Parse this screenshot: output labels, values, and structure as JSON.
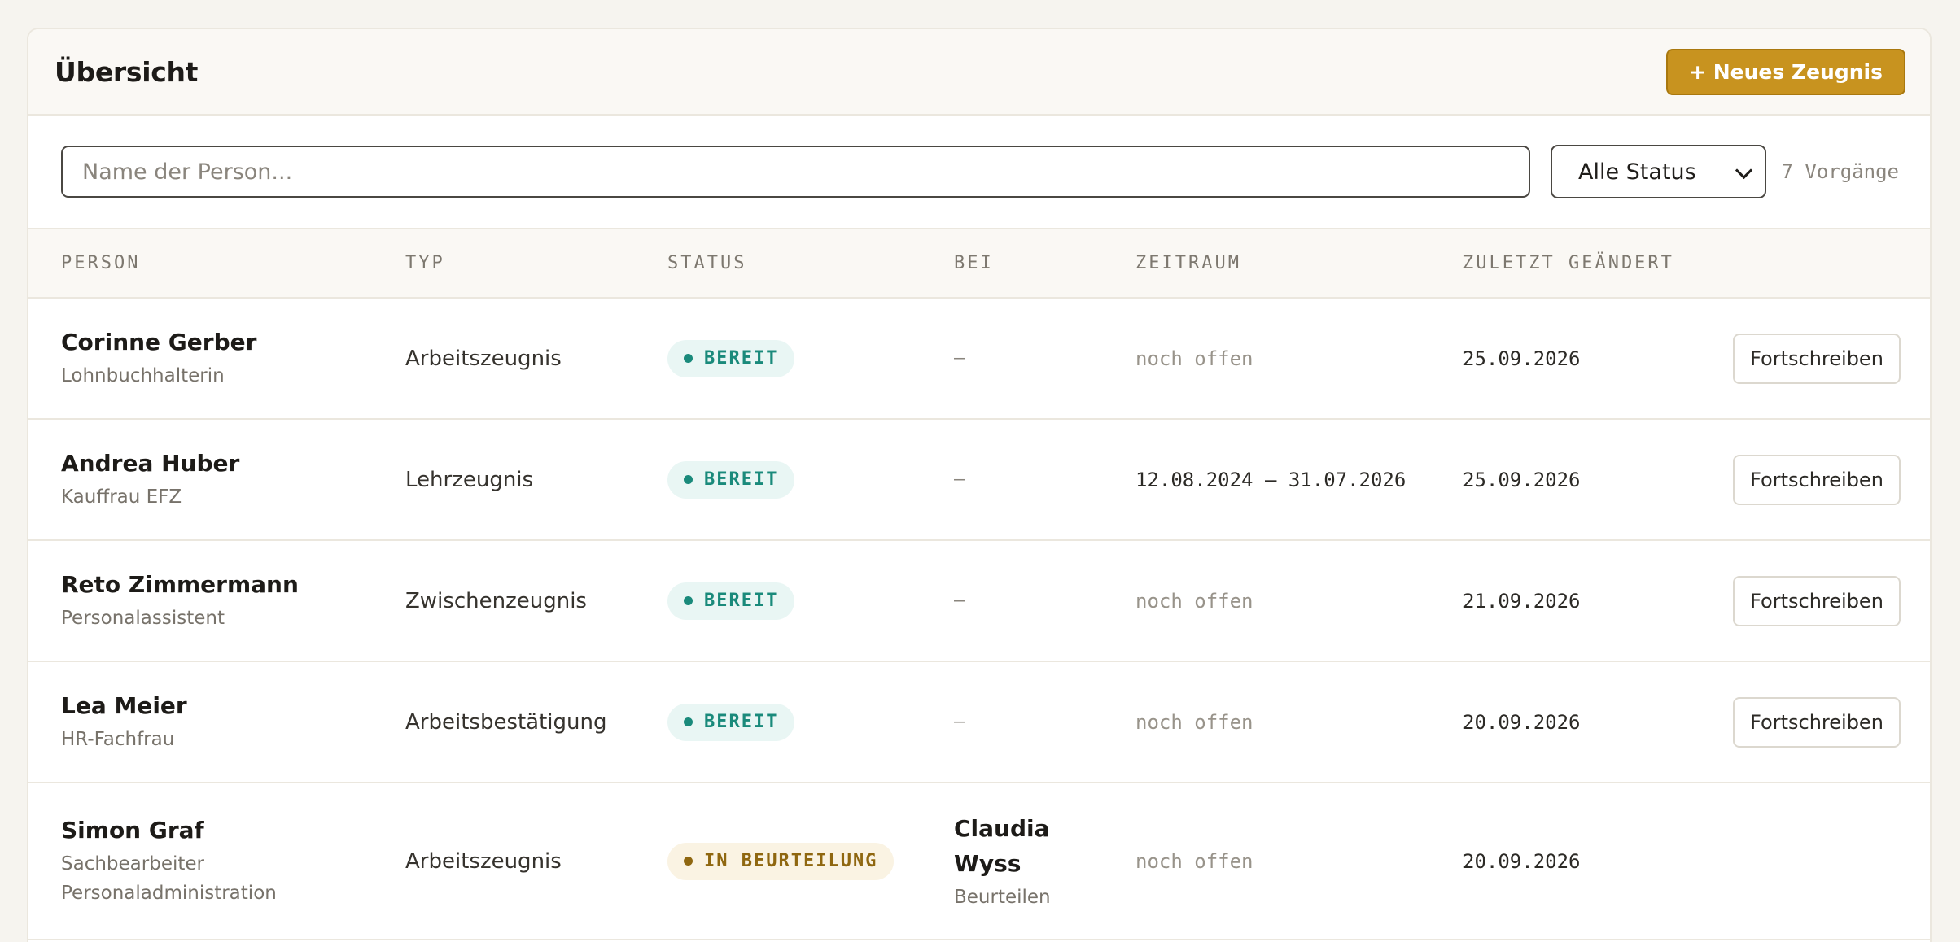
{
  "header": {
    "title": "Übersicht",
    "new_button_label": "+ Neues Zeugnis"
  },
  "toolbar": {
    "search_placeholder": "Name der Person...",
    "search_value": "",
    "status_filter_selected": "Alle Status",
    "count_label": "7 Vorgänge"
  },
  "table": {
    "columns": [
      "PERSON",
      "TYP",
      "STATUS",
      "BEI",
      "ZEITRAUM",
      "ZULETZT GEÄNDERT"
    ],
    "rows": [
      {
        "name": "Corinne Gerber",
        "role": "Lohnbuchhalterin",
        "type": "Arbeitszeugnis",
        "status": "BEREIT",
        "assignee": "—",
        "assignee_action": "",
        "period": "noch offen",
        "changed": "25.09.2026",
        "action": "Fortschreiben"
      },
      {
        "name": "Andrea Huber",
        "role": "Kauffrau EFZ",
        "type": "Lehrzeugnis",
        "status": "BEREIT",
        "assignee": "—",
        "assignee_action": "",
        "period": "12.08.2024 – 31.07.2026",
        "changed": "25.09.2026",
        "action": "Fortschreiben"
      },
      {
        "name": "Reto Zimmermann",
        "role": "Personalassistent",
        "type": "Zwischenzeugnis",
        "status": "BEREIT",
        "assignee": "—",
        "assignee_action": "",
        "period": "noch offen",
        "changed": "21.09.2026",
        "action": "Fortschreiben"
      },
      {
        "name": "Lea Meier",
        "role": "HR-Fachfrau",
        "type": "Arbeitsbestätigung",
        "status": "BEREIT",
        "assignee": "—",
        "assignee_action": "",
        "period": "noch offen",
        "changed": "20.09.2026",
        "action": "Fortschreiben"
      },
      {
        "name": "Simon Graf",
        "role": "Sachbearbeiter Personaladministration",
        "type": "Arbeitszeugnis",
        "status": "IN BEURTEILUNG",
        "assignee": "Claudia Wyss",
        "assignee_action": "Beurteilen",
        "period": "noch offen",
        "changed": "20.09.2026",
        "action": ""
      }
    ]
  },
  "colors": {
    "accent": "#c8931f",
    "status_ready": "#1a8a7b",
    "status_review": "#8f6710"
  }
}
